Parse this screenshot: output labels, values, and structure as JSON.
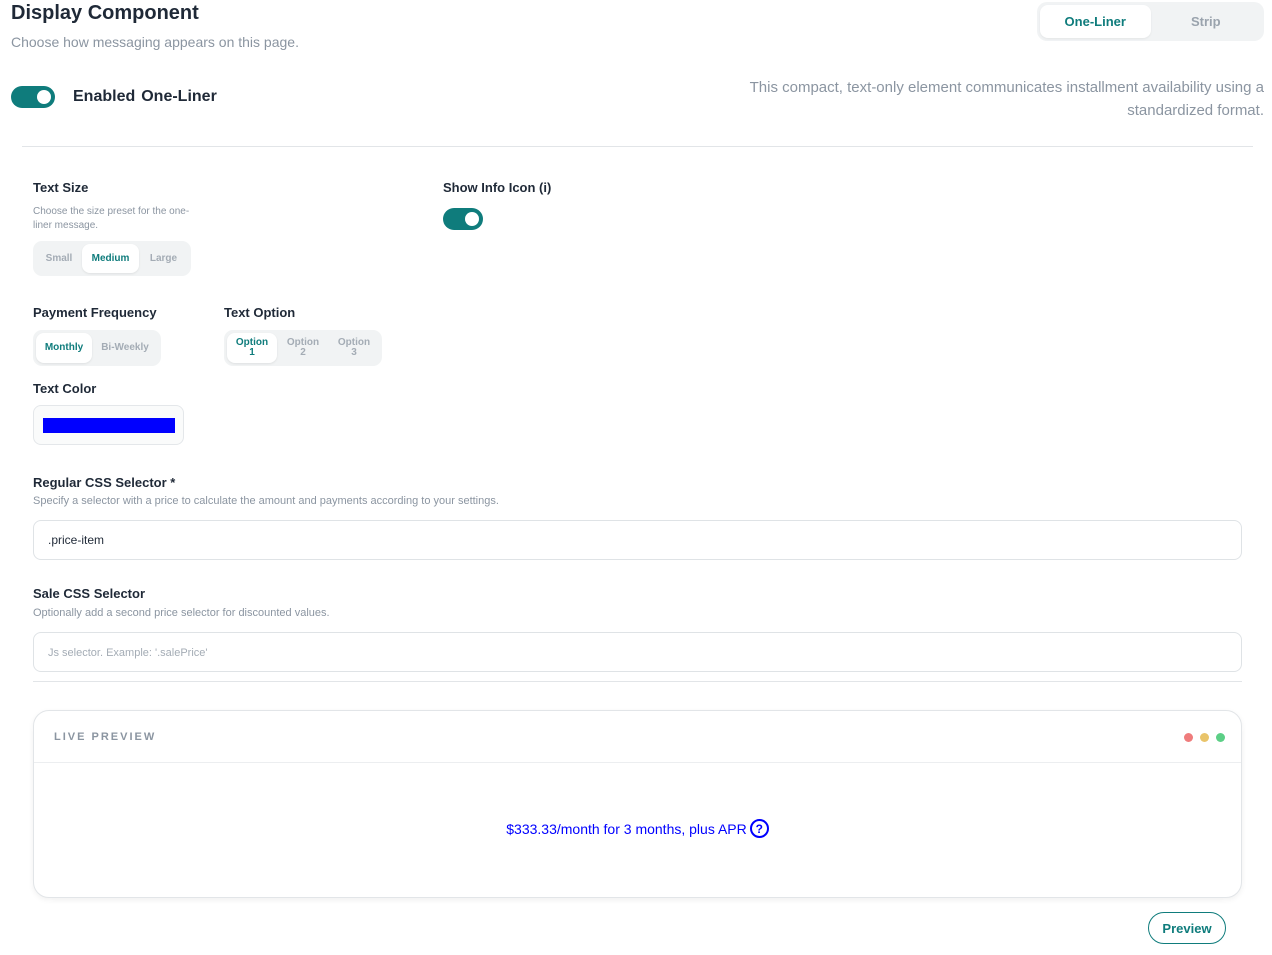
{
  "header": {
    "title": "Display Component",
    "subtitle": "Choose how messaging appears on this page.",
    "tabs": [
      {
        "label": "One-Liner",
        "active": true
      },
      {
        "label": "Strip",
        "active": false
      }
    ]
  },
  "enabled": {
    "on": true,
    "label_prefix": "Enabled",
    "label_component": "One-Liner",
    "description": "This compact, text-only element communicates installment availability using a standardized format."
  },
  "text_size": {
    "label": "Text Size",
    "hint": "Choose the size preset for the one-liner message.",
    "options": [
      "Small",
      "Medium",
      "Large"
    ],
    "selected": "Medium"
  },
  "info_icon": {
    "label": "Show Info Icon (i)",
    "on": true
  },
  "payment_frequency": {
    "label": "Payment Frequency",
    "options": [
      "Monthly",
      "Bi-Weekly"
    ],
    "selected": "Monthly"
  },
  "text_option": {
    "label": "Text Option",
    "options": [
      "Option 1",
      "Option 2",
      "Option 3"
    ],
    "selected": "Option 1"
  },
  "text_color": {
    "label": "Text Color",
    "value": "#0000ff"
  },
  "regular_selector": {
    "label": "Regular CSS Selector *",
    "hint": "Specify a selector with a price to calculate the amount and payments according to your settings.",
    "value": ".price-item"
  },
  "sale_selector": {
    "label": "Sale CSS Selector",
    "hint": "Optionally add a second price selector for discounted values.",
    "value": "",
    "placeholder": "Js selector. Example: '.salePrice'"
  },
  "live_preview": {
    "title": "LIVE PREVIEW",
    "message": "$333.33/month for 3 months, plus APR",
    "info_glyph": "?",
    "dot_colors": [
      "#ef7c7c",
      "#e9c46a",
      "#5ccf86"
    ]
  },
  "preview_button": "Preview",
  "colors": {
    "accent": "#0f7c7c",
    "message_text": "#0000ff"
  }
}
